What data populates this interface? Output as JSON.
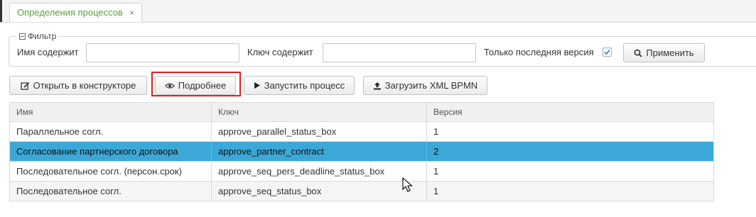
{
  "tab": {
    "label": "Определения процессов",
    "close": "×"
  },
  "filter": {
    "legend": "Фильтр",
    "name_label": "Имя содержит",
    "name_value": "",
    "key_label": "Ключ содержит",
    "key_value": "",
    "latest_label": "Только последняя версия",
    "latest_checked": true,
    "apply_label": "Применить"
  },
  "toolbar": {
    "open_designer": "Открыть в конструкторе",
    "details": "Подробнее",
    "start_process": "Запустить процесс",
    "upload_xml": "Загрузить XML BPMN"
  },
  "table": {
    "columns": [
      "Имя",
      "Ключ",
      "Версия"
    ],
    "rows": [
      {
        "name": "Параллельное согл.",
        "key": "approve_parallel_status_box",
        "version": "1",
        "selected": false
      },
      {
        "name": "Согласование партнерского договора",
        "key": "approve_partner_contract",
        "version": "2",
        "selected": true
      },
      {
        "name": "Последовательное согл. (персон.срок)",
        "key": "approve_seq_pers_deadline_status_box",
        "version": "1",
        "selected": false
      },
      {
        "name": "Последовательное согл.",
        "key": "approve_seq_status_box",
        "version": "1",
        "selected": false
      }
    ]
  },
  "colors": {
    "tab_text": "#5aa23c",
    "selected_row": "#3ba8d8",
    "highlight_border": "#dd2222"
  },
  "icons": {
    "legend": "minus-square-icon",
    "apply": "search-icon",
    "open_designer": "edit-icon",
    "details": "eye-icon",
    "start_process": "play-icon",
    "upload_xml": "upload-icon"
  }
}
